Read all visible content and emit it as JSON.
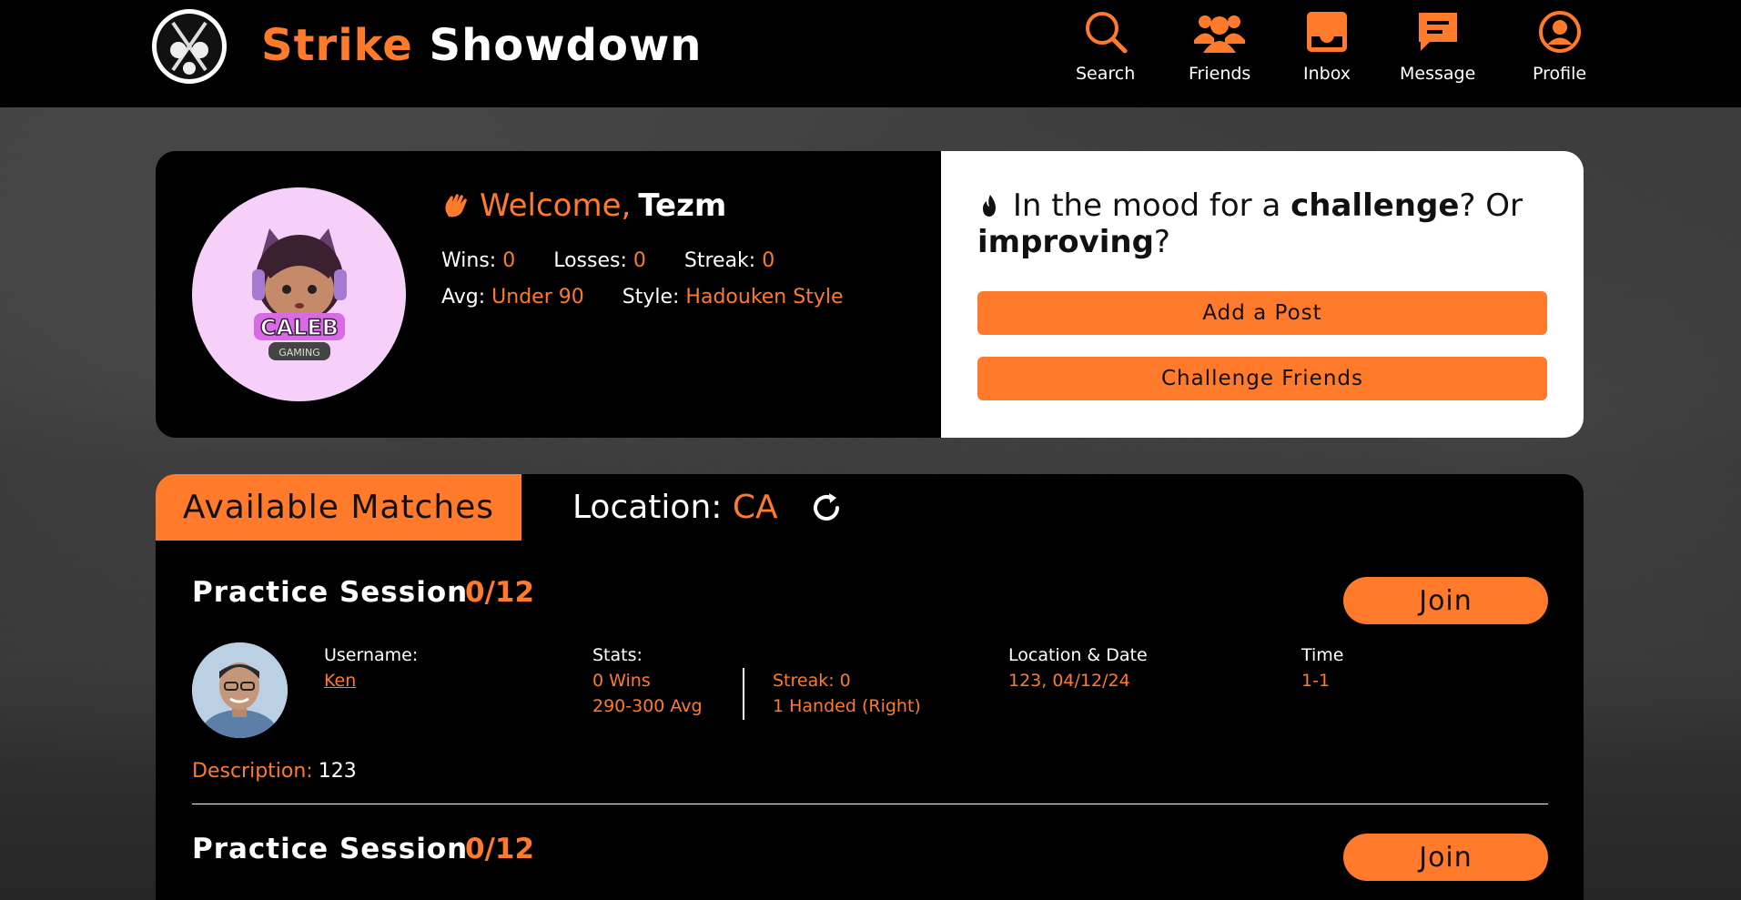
{
  "brand": {
    "part1": "Strike",
    "part2": "Showdown"
  },
  "nav": [
    {
      "label": "Search",
      "icon": "search-icon"
    },
    {
      "label": "Friends",
      "icon": "friends-icon"
    },
    {
      "label": "Inbox",
      "icon": "inbox-icon"
    },
    {
      "label": "Message",
      "icon": "message-icon"
    },
    {
      "label": "Profile",
      "icon": "profile-icon"
    }
  ],
  "welcome": {
    "greeting": "Welcome,",
    "username": "Tezm",
    "wins_label": "Wins:",
    "wins": "0",
    "losses_label": "Losses:",
    "losses": "0",
    "streak_label": "Streak:",
    "streak": "0",
    "avg_label": "Avg:",
    "avg": "Under 90",
    "style_label": "Style:",
    "style": "Hadouken Style",
    "avatar_text": "CALEB",
    "avatar_subtext": "GAMING"
  },
  "mood": {
    "t1": "In the mood for a ",
    "b1": "challenge",
    "t2": "? Or ",
    "b2": "improving",
    "t3": "?",
    "add_post": "Add a Post",
    "challenge_friends": "Challenge Friends"
  },
  "matches": {
    "tab_label": "Available Matches",
    "location_label": "Location:",
    "location_value": "CA",
    "items": [
      {
        "title": "Practice Session",
        "count": "0/12",
        "join": "Join",
        "username_label": "Username:",
        "username": "Ken",
        "stats_label": "Stats:",
        "wins": "0 Wins",
        "avg": "290-300 Avg",
        "streak": "Streak: 0",
        "hand": "1 Handed (Right)",
        "locdate_label": "Location & Date",
        "locdate": "123, 04/12/24",
        "time_label": "Time",
        "time": "1-1",
        "desc_label": "Description:",
        "desc": "123"
      },
      {
        "title": "Practice Session",
        "count": "0/12",
        "join": "Join"
      }
    ]
  },
  "colors": {
    "accent": "#ff7a2a",
    "bar": "#000000",
    "card_light": "#ffffff"
  }
}
